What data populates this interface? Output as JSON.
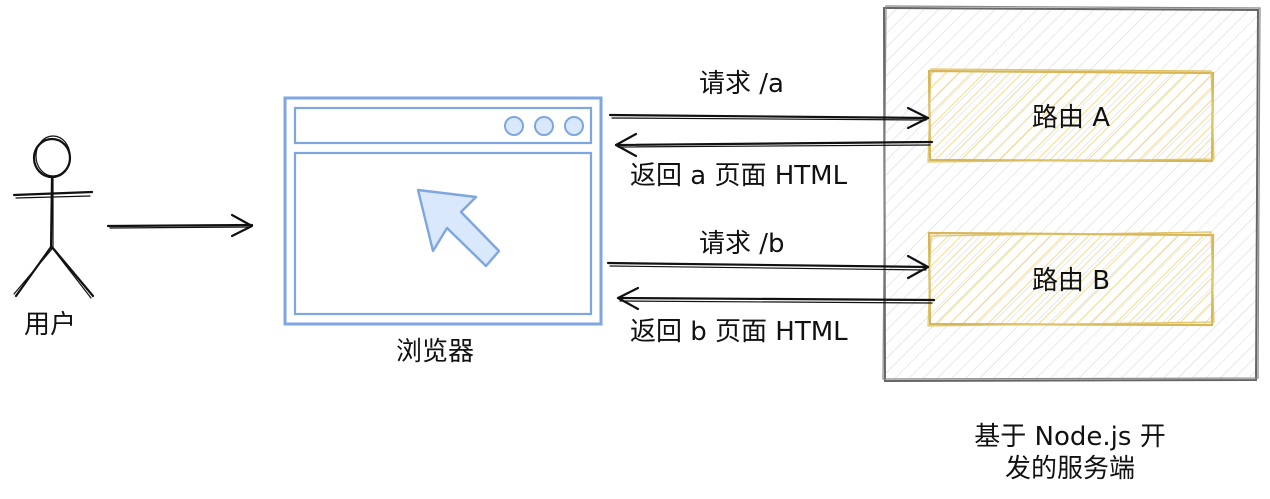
{
  "colors": {
    "ink": "#111111",
    "browser_stroke": "#7ea6e0",
    "browser_fill": "#dae8fc",
    "route_stroke": "#d6b656",
    "route_fill": "#fff2cc",
    "server_stroke": "#666666",
    "server_hatch": "#cfcfcf"
  },
  "icons": {
    "user": "stick-figure-icon",
    "browser": "browser-window-icon",
    "cursor": "cursor-arrow-icon"
  },
  "user": {
    "label": "用户"
  },
  "browser": {
    "label": "浏览器"
  },
  "server": {
    "label_line1": "基于 Node.js 开",
    "label_line2": "发的服务端"
  },
  "routes": {
    "a": {
      "label": "路由 A"
    },
    "b": {
      "label": "路由 B"
    }
  },
  "arrows": {
    "request_a": "请求 /a",
    "response_a": "返回 a 页面 HTML",
    "request_b": "请求 /b",
    "response_b": "返回 b 页面 HTML"
  }
}
